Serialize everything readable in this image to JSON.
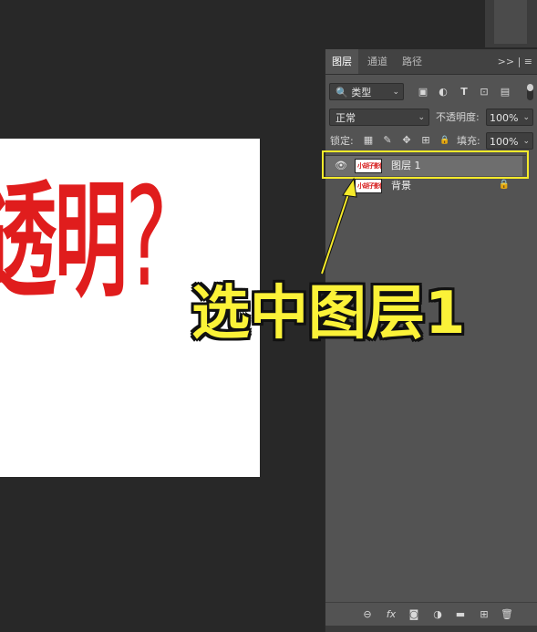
{
  "canvas": {
    "text": "透明",
    "question_mark": "?",
    "text_color": "#e01d1d"
  },
  "panel": {
    "tabs": [
      {
        "label": "图层",
        "active": true
      },
      {
        "label": "通道",
        "active": false
      },
      {
        "label": "路径",
        "active": false
      }
    ],
    "tab_menu": ">> | ≡",
    "filter": {
      "selected": "类型",
      "icons": [
        "image-filter-icon",
        "adjustment-filter-icon",
        "type-filter-icon",
        "shape-filter-icon",
        "smart-object-filter-icon"
      ],
      "icon_glyphs": [
        "▣",
        "◐",
        "T",
        "⊡",
        "▤"
      ]
    },
    "blend_mode": "正常",
    "opacity_label": "不透明度:",
    "opacity_value": "100%",
    "lock_label": "锁定:",
    "lock_icons": [
      "lock-transparent-icon",
      "lock-image-icon",
      "lock-position-icon",
      "lock-artboard-icon",
      "lock-all-icon"
    ],
    "lock_glyphs": [
      "▦",
      "✎",
      "✥",
      "⊞",
      "🔒"
    ],
    "fill_label": "填充:",
    "fill_value": "100%",
    "layers": [
      {
        "name": "图层 1",
        "thumb_text": "小胡子影像",
        "visible": true,
        "selected": true,
        "locked": false
      },
      {
        "name": "背景",
        "thumb_text": "小胡子影像",
        "visible": false,
        "selected": false,
        "locked": true
      }
    ],
    "footer_icons": [
      "link-layers-icon",
      "fx-icon",
      "layer-mask-icon",
      "adjustment-layer-icon",
      "group-folder-icon",
      "new-layer-icon",
      "trash-icon"
    ],
    "footer_glyphs": [
      "⊖",
      "fx",
      "◙",
      "◑",
      "▬",
      "⊞",
      "🗑"
    ]
  },
  "annotation": {
    "text": "选中图层1",
    "color": "#fbf238"
  },
  "colors": {
    "workspace": "#282828",
    "panel": "#535353",
    "selected_row": "#6e6e6e",
    "highlight": "#f5ea2a"
  }
}
